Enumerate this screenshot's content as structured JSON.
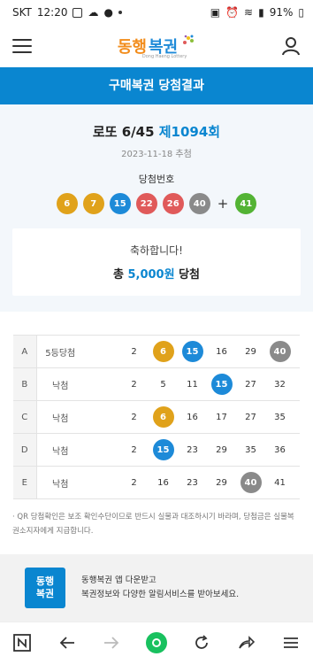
{
  "status": {
    "carrier": "SKT",
    "time": "12:20",
    "battery": "91%"
  },
  "header": {
    "logo_text_1": "동행",
    "logo_text_2": "복권",
    "logo_sub": "Dong Haeng Lottery"
  },
  "title": "구매복권 당첨결과",
  "round": {
    "game": "로또 6/45",
    "draw": "제1094회",
    "date": "2023-11-18 추첨"
  },
  "winning": {
    "label": "당첨번호",
    "numbers": [
      "6",
      "7",
      "15",
      "22",
      "26",
      "40"
    ],
    "colors": [
      "#e0a21b",
      "#e0a21b",
      "#1d8ad8",
      "#e05a5a",
      "#e05a5a",
      "#8a8a8a"
    ],
    "plus": "+",
    "bonus": "41",
    "bonus_color": "#53b334"
  },
  "congrats": {
    "line1": "축하합니다!",
    "prefix": "총",
    "amount": "5,000원",
    "suffix": "당첨"
  },
  "games": [
    {
      "id": "A",
      "result": "5등당첨",
      "numbers": [
        "2",
        "6",
        "15",
        "16",
        "29",
        "40"
      ],
      "hits": [
        null,
        "#e0a21b",
        "#1d8ad8",
        null,
        null,
        "#8a8a8a"
      ]
    },
    {
      "id": "B",
      "result": "낙첨",
      "numbers": [
        "2",
        "5",
        "11",
        "15",
        "27",
        "32"
      ],
      "hits": [
        null,
        null,
        null,
        "#1d8ad8",
        null,
        null
      ]
    },
    {
      "id": "C",
      "result": "낙첨",
      "numbers": [
        "2",
        "6",
        "16",
        "17",
        "27",
        "35"
      ],
      "hits": [
        null,
        "#e0a21b",
        null,
        null,
        null,
        null
      ]
    },
    {
      "id": "D",
      "result": "낙첨",
      "numbers": [
        "2",
        "15",
        "23",
        "29",
        "35",
        "36"
      ],
      "hits": [
        null,
        "#1d8ad8",
        null,
        null,
        null,
        null
      ]
    },
    {
      "id": "E",
      "result": "낙첨",
      "numbers": [
        "2",
        "16",
        "23",
        "29",
        "40",
        "41"
      ],
      "hits": [
        null,
        null,
        null,
        null,
        "#8a8a8a",
        null
      ]
    }
  ],
  "notice": "· QR 당첨확인은 보조 확인수단이므로 반드시 실물과 대조하시기 바라며, 당첨금은 실물복권소지자에게 지급합니다.",
  "promo": {
    "logo_1": "동행",
    "logo_2": "복권",
    "line1": "동행복권 앱 다운받고",
    "line2": "복권정보와 다양한 알림서비스를 받아보세요."
  }
}
